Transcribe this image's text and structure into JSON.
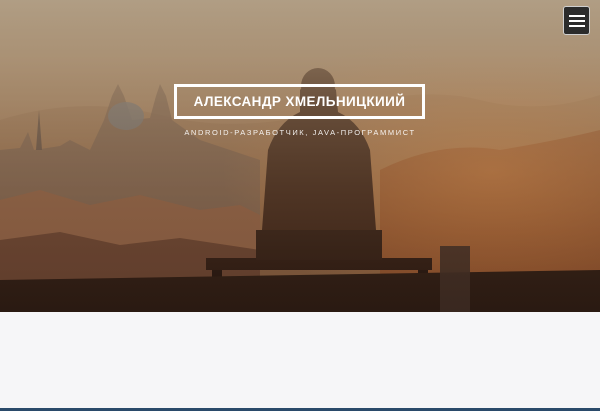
{
  "header": {
    "menu_icon": "hamburger-menu-icon"
  },
  "hero": {
    "title": "АЛЕКСАНДР ХМЕЛЬНИЦКИИЙ",
    "subtitle": "ANDROID-РАЗРАБОТЧИК, JAVA-ПРОГРАММИСТ"
  },
  "colors": {
    "hero_overlay_top": "#9d8a73",
    "hero_overlay_bottom": "#4a2c1a",
    "menu_button_bg": "#2b2b2b",
    "title_border": "#ffffff",
    "page_background": "#f6f6f8"
  }
}
